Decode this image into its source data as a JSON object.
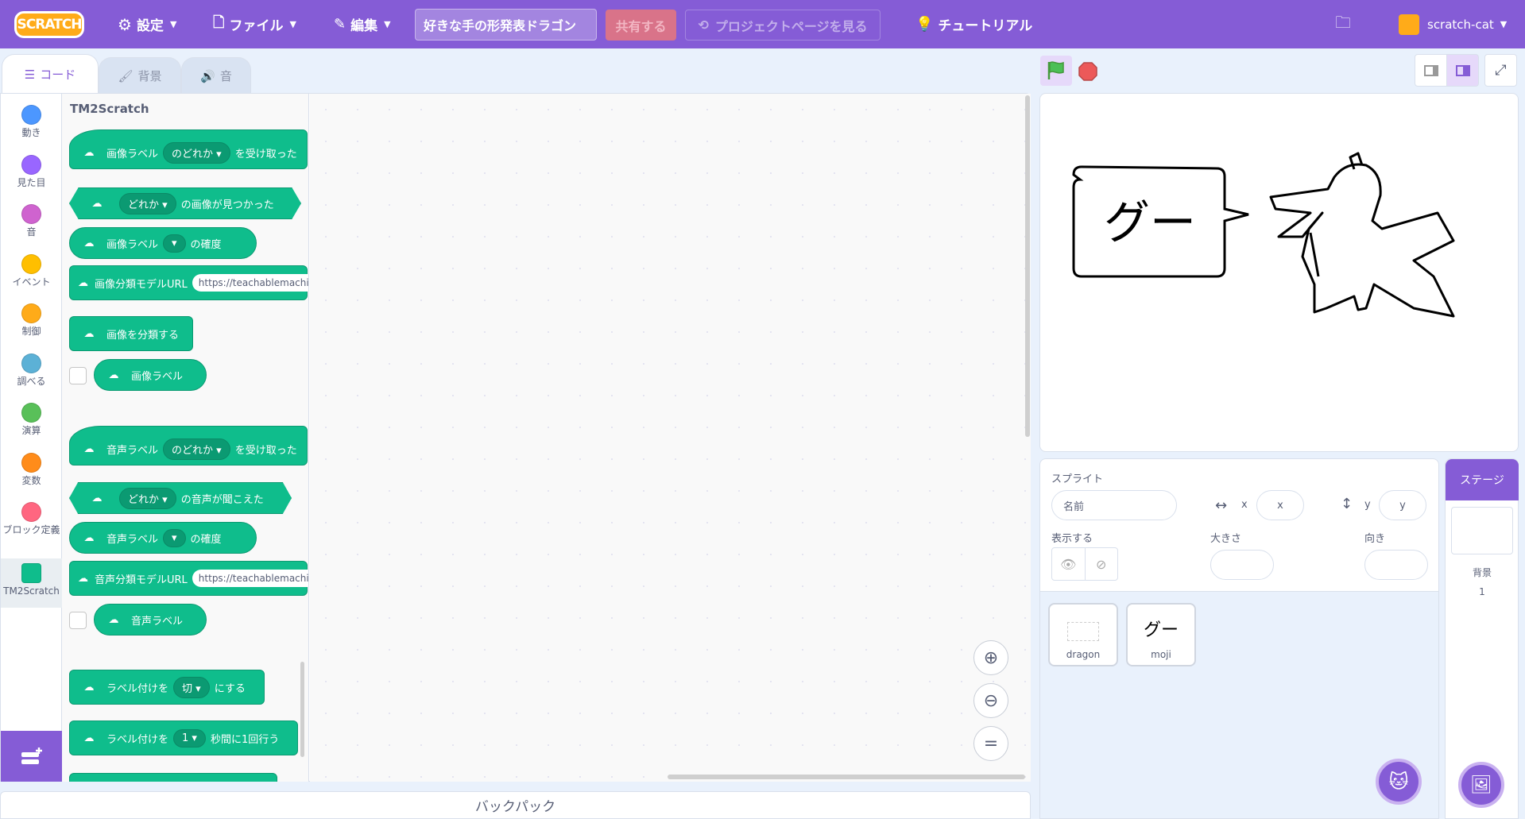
{
  "menu": {
    "logo": "SCRATCH",
    "settings": "設定",
    "file": "ファイル",
    "edit": "編集",
    "project_title": "好きな手の形発表ドラゴン",
    "share": "共有する",
    "project_page": "プロジェクトページを見る",
    "tutorials": "チュートリアル",
    "username": "scratch-cat"
  },
  "tabs": {
    "code": "コード",
    "costumes": "背景",
    "sounds": "音"
  },
  "categories": [
    {
      "label": "動き",
      "color": "#4c97ff"
    },
    {
      "label": "見た目",
      "color": "#9966ff"
    },
    {
      "label": "音",
      "color": "#cf63cf"
    },
    {
      "label": "イベント",
      "color": "#ffbf00"
    },
    {
      "label": "制御",
      "color": "#ffab19"
    },
    {
      "label": "調べる",
      "color": "#5cb1d6"
    },
    {
      "label": "演算",
      "color": "#59c059"
    },
    {
      "label": "変数",
      "color": "#ff8c1a"
    },
    {
      "label": "ブロック定義",
      "color": "#ff6680"
    },
    {
      "label": "TM2Scratch",
      "color": "#0fbd8c"
    }
  ],
  "palette": {
    "title": "TM2Scratch",
    "b1": {
      "a": "画像ラベル",
      "dd": "のどれか",
      "b": "を受け取った"
    },
    "b2": {
      "dd": "どれか",
      "b": "の画像が見つかった"
    },
    "b3": {
      "a": "画像ラベル",
      "b": "の確度"
    },
    "b4": {
      "a": "画像分類モデルURL",
      "inp": "https://teachablemachine"
    },
    "b5": {
      "a": "画像を分類する"
    },
    "b6": {
      "a": "画像ラベル"
    },
    "b7": {
      "a": "音声ラベル",
      "dd": "のどれか",
      "b": "を受け取った"
    },
    "b8": {
      "dd": "どれか",
      "b": "の音声が聞こえた"
    },
    "b9": {
      "a": "音声ラベル",
      "b": "の確度"
    },
    "b10": {
      "a": "音声分類モデルURL",
      "inp": "https://teachablemachine"
    },
    "b11": {
      "a": "音声ラベル"
    },
    "b12": {
      "a": "ラベル付けを",
      "dd": "切",
      "b": "にする"
    },
    "b13": {
      "a": "ラベル付けを",
      "dd": "1",
      "b": "秒間に1回行う"
    }
  },
  "backpack": "バックパック",
  "stage": {
    "speech": "グー"
  },
  "sprite_info": {
    "sprite_label": "スプライト",
    "name_placeholder": "名前",
    "x_label": "x",
    "x_placeholder": "x",
    "y_label": "y",
    "y_placeholder": "y",
    "show_label": "表示する",
    "size_label": "大きさ",
    "direction_label": "向き"
  },
  "sprites": [
    {
      "name": "dragon",
      "thumb": ""
    },
    {
      "name": "moji",
      "thumb": "グー"
    }
  ],
  "stage_panel": {
    "tab": "ステージ",
    "backdrops_label": "背景",
    "backdrops_count": "1"
  }
}
